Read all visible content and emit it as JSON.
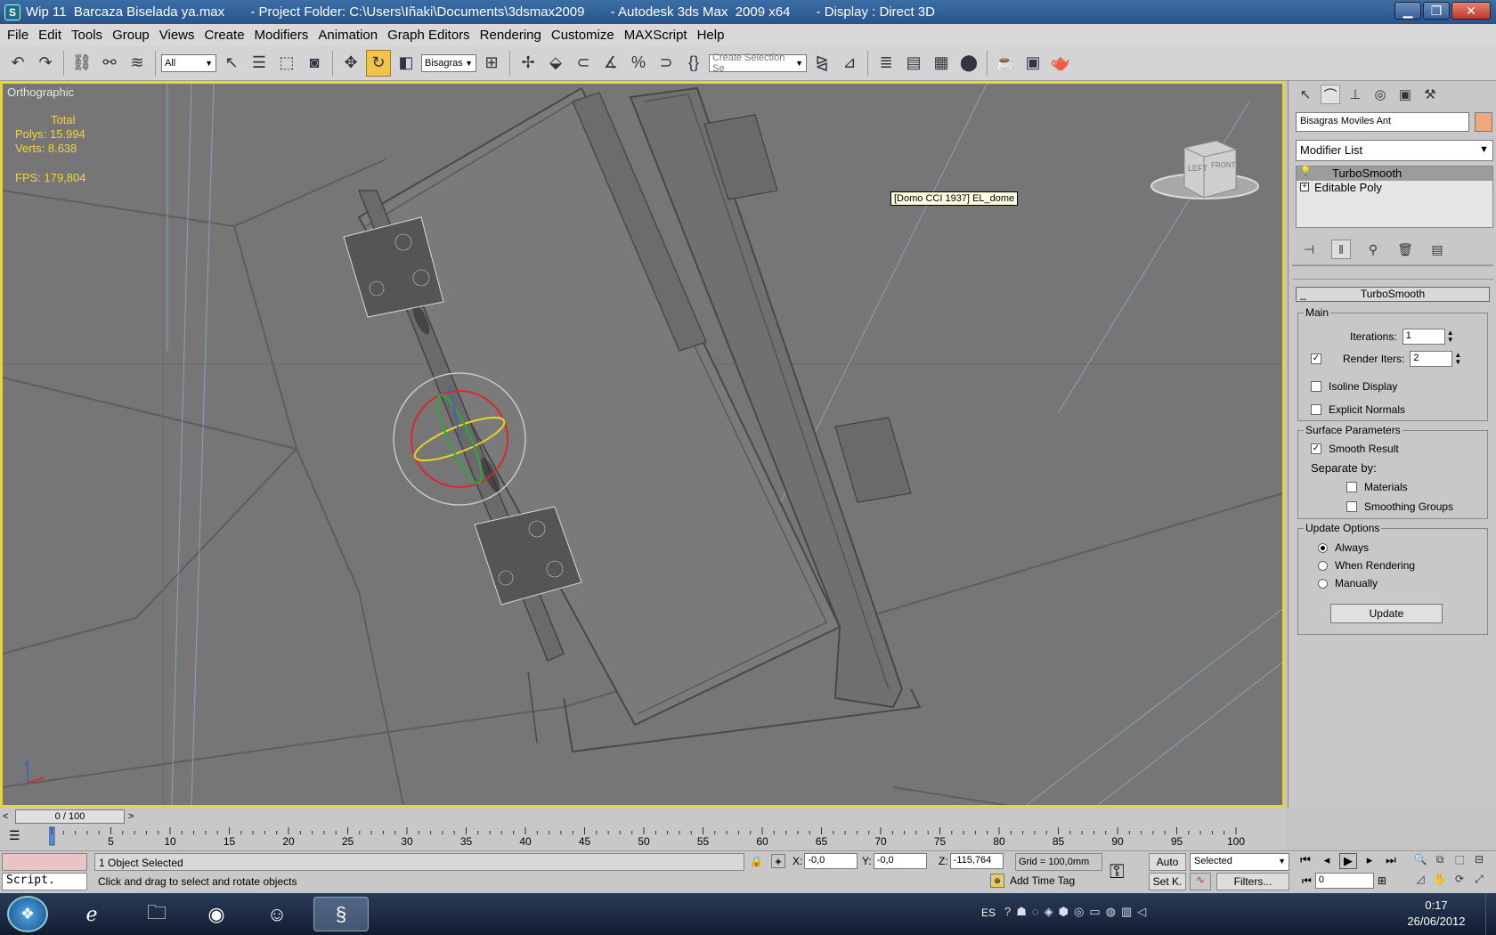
{
  "window": {
    "title": "Wip 11  Barcaza Biselada ya.max       - Project Folder: C:\\Users\\Iñaki\\Documents\\3dsmax2009       - Autodesk 3ds Max  2009 x64       - Display : Direct 3D",
    "app_icon": "3ds-max-icon",
    "minimize": "▁",
    "maximize": "❐",
    "close": "✕"
  },
  "menu": [
    "File",
    "Edit",
    "Tools",
    "Group",
    "Views",
    "Create",
    "Modifiers",
    "Animation",
    "Graph Editors",
    "Rendering",
    "Customize",
    "MAXScript",
    "Help"
  ],
  "toolbar": {
    "selection_filter": "All",
    "reference_coord": "Bisagras",
    "named_selection_placeholder": "Create Selection Se",
    "active_tool": "rotate-icon"
  },
  "viewport": {
    "label": "Orthographic",
    "stats": {
      "total_label": "Total",
      "polys": "Polys: 15.994",
      "verts": "Verts: 8.638",
      "fps": "FPS:   179,804"
    },
    "tooltip": "[Domo CCI 1937] EL_dome",
    "viewcube": {
      "left": "LEFT",
      "front": "FRONT"
    },
    "axis": {
      "z": "z",
      "x": "x"
    },
    "border_color": "#e8d43a",
    "stats_color": "#f3d43a"
  },
  "command_panel": {
    "object_name": "Bisagras Moviles Ant",
    "object_color": "#f0a878",
    "modifier_list": "Modifier List",
    "stack": [
      {
        "label": "TurboSmooth",
        "icon": "💡"
      },
      {
        "label": "Editable Poly",
        "icon": "+"
      }
    ],
    "rollout_title": "TurboSmooth",
    "main": {
      "title": "Main",
      "iterations_label": "Iterations:",
      "iterations": "1",
      "render_iters_label": "Render Iters:",
      "render_iters": "2",
      "isoline_label": "Isoline Display",
      "explicit_normals_label": "Explicit Normals"
    },
    "surface": {
      "title": "Surface Parameters",
      "smooth_result_label": "Smooth Result",
      "separate_by": "Separate by:",
      "materials_label": "Materials",
      "smoothing_groups_label": "Smoothing Groups"
    },
    "update_options": {
      "title": "Update Options",
      "always": "Always",
      "when_rendering": "When Rendering",
      "manually": "Manually",
      "update_button": "Update"
    }
  },
  "timeline": {
    "slider_label": "0 / 100",
    "prev": "<",
    "next": ">",
    "ticks": [
      "5",
      "10",
      "15",
      "20",
      "25",
      "30",
      "35",
      "40",
      "45",
      "50",
      "55",
      "60",
      "65",
      "70",
      "75",
      "80",
      "85",
      "90",
      "95",
      "100"
    ]
  },
  "status": {
    "maxscript": "Script.",
    "selection": "1 Object Selected",
    "prompt": "Click and drag to select and rotate objects",
    "x_label": "X:",
    "x": "-0,0",
    "y_label": "Y:",
    "y": "-0,0",
    "z_label": "Z:",
    "z": "-115,764",
    "grid": "Grid = 100,0mm",
    "add_time_tag": "Add Time Tag",
    "auto_key": "Auto",
    "set_key": "Set K.",
    "key_filter": "Selected",
    "filters": "Filters...",
    "frame": "0"
  },
  "taskbar": {
    "language": "ES",
    "time": "0:17",
    "date": "26/06/2012"
  }
}
